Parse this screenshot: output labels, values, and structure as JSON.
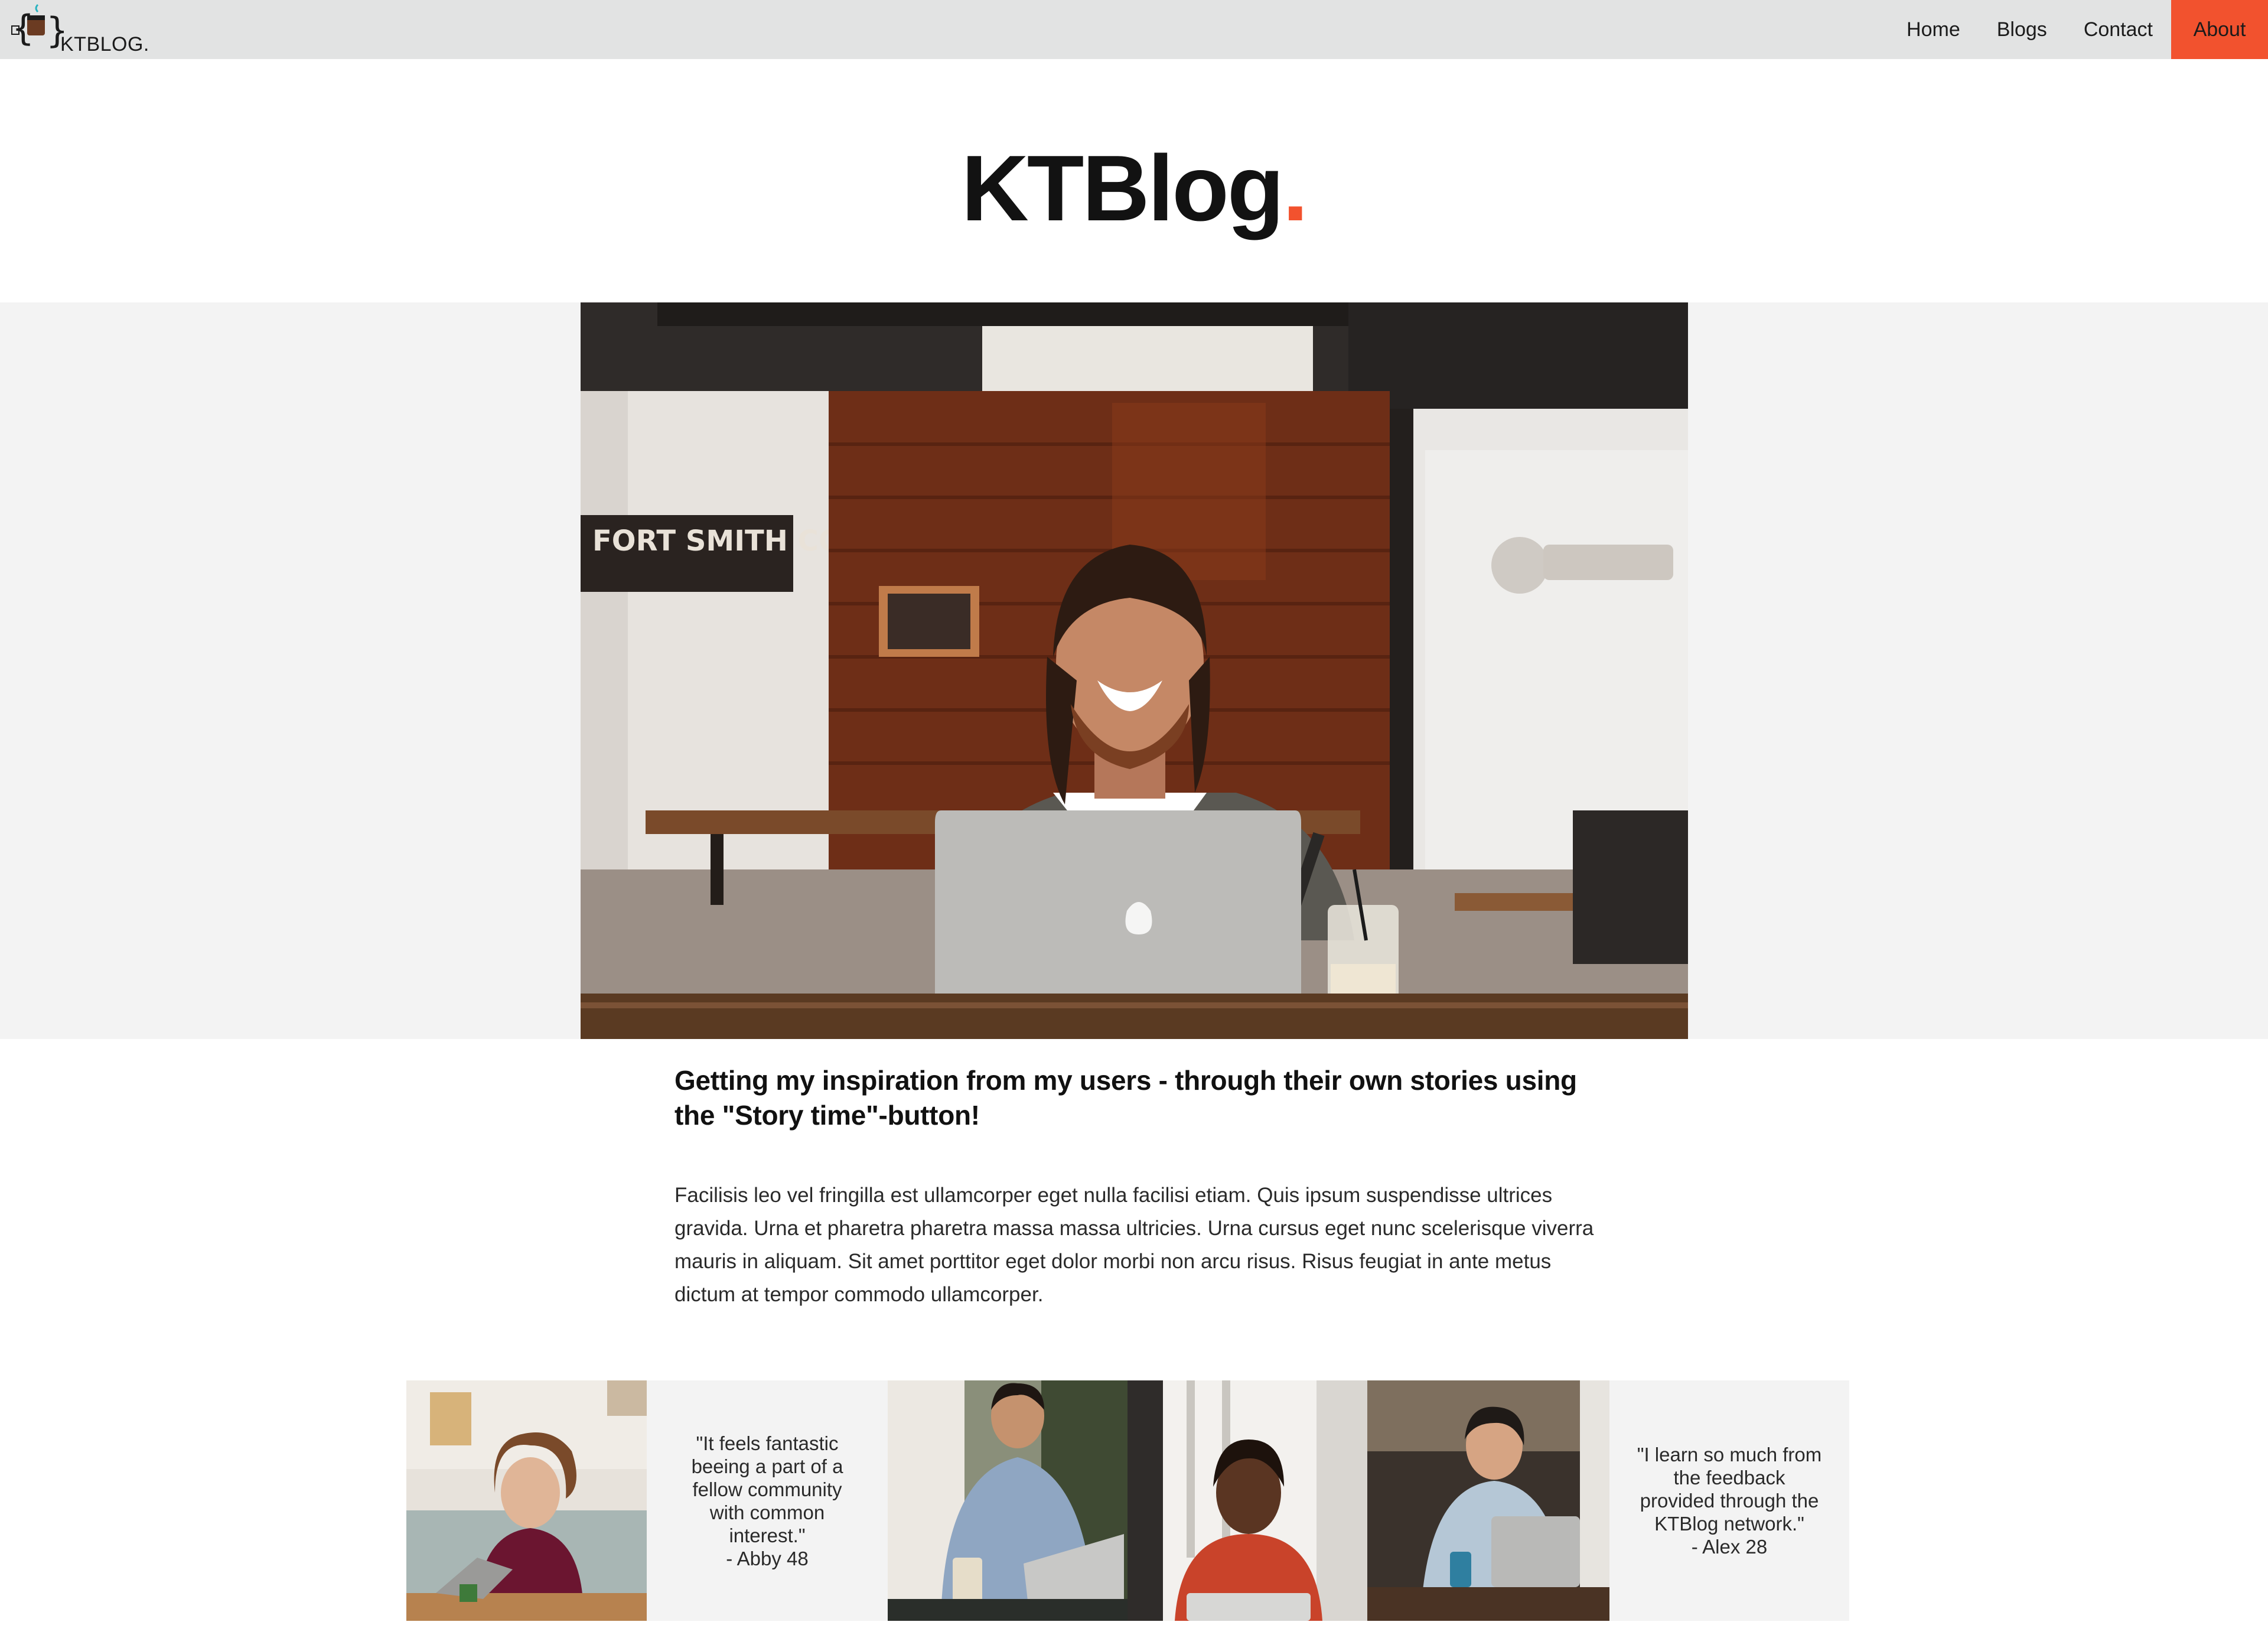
{
  "navbar": {
    "logo_icon": "coffee-braces-icon",
    "logo_text": "KTBLOG.",
    "links": [
      {
        "label": "Home"
      },
      {
        "label": "Blogs"
      },
      {
        "label": "Contact"
      },
      {
        "label": "About",
        "active": true
      }
    ],
    "accent_color": "#f2522e"
  },
  "hero": {
    "title": "KTBlog",
    "title_dot": ".",
    "photo": "man-smiling-with-laptop-in-cafe-photo",
    "sign_text": "FORT SMITH COFFEE CO"
  },
  "article": {
    "heading": "Getting my inspiration from my users - through their own stories using the \"Story time\"-button!",
    "body": "Facilisis leo vel fringilla est ullamcorper eget nulla facilisi etiam. Quis ipsum suspendisse ultrices gravida. Urna et pharetra pharetra massa massa ultricies. Urna cursus eget nunc scelerisque viverra mauris in aliquam. Sit amet porttitor eget dolor morbi non arcu risus. Risus feugiat in ante metus dictum at tempor commodo ullamcorper."
  },
  "testimonials": {
    "photos": [
      "woman-with-glasses-using-laptop-photo",
      "man-with-laptop-outdoors-photo",
      "woman-smiling-with-laptop-photo",
      "person-smiling-with-laptop-photo"
    ],
    "quotes": [
      {
        "lines": [
          "\"It feels fantastic",
          "beeing a part of a",
          "fellow community",
          "with common",
          "interest.\""
        ],
        "author": "- Abby 48"
      },
      {
        "lines": [
          "\"I learn so much from",
          "the feedback",
          "provided through the",
          "KTBlog network.\""
        ],
        "author": "- Alex 28"
      }
    ]
  }
}
